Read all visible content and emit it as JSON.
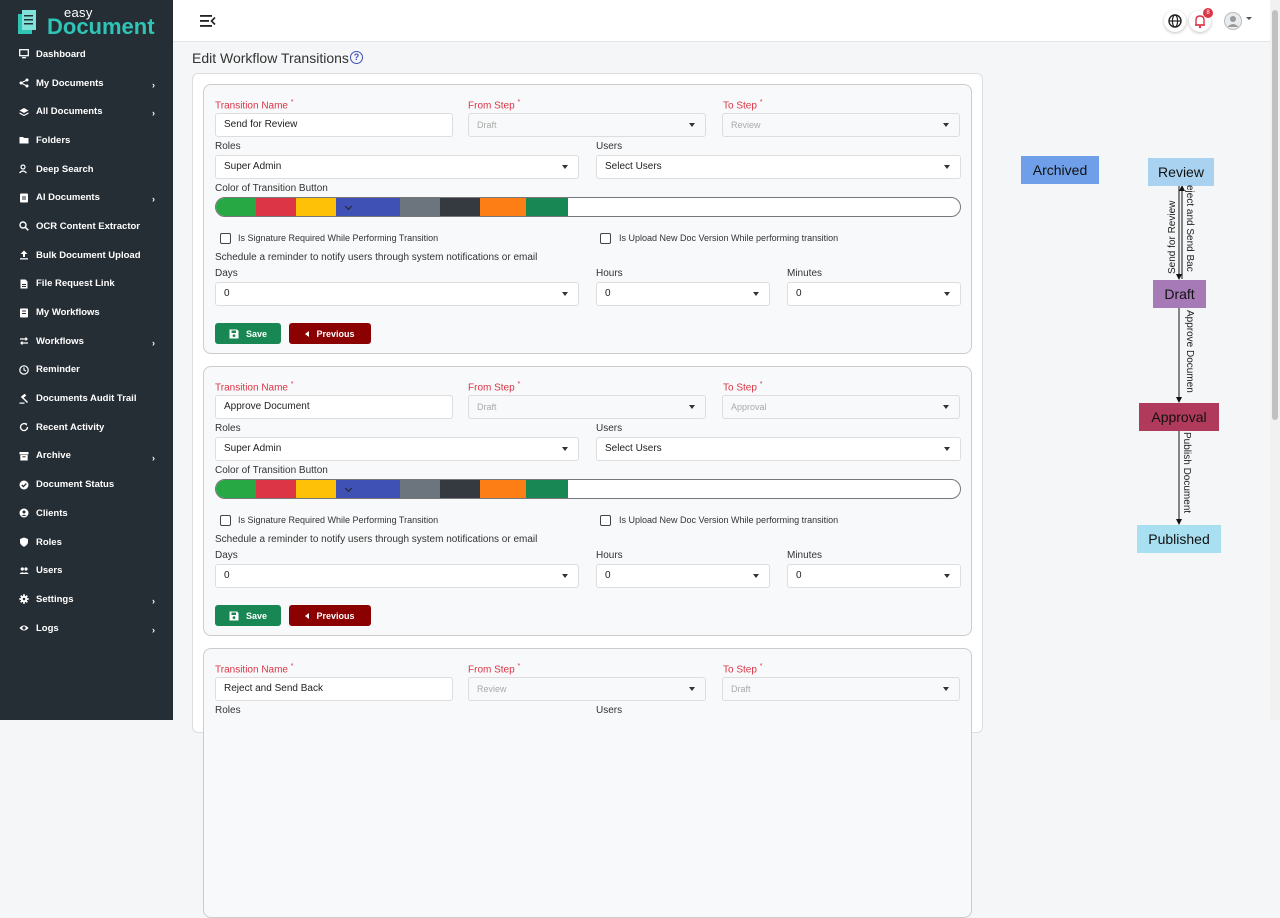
{
  "app": {
    "logo_small": "easy",
    "logo_large": "Document",
    "notification_count": "8",
    "page_title": "Edit Workflow Transitions",
    "help_glyph": "?"
  },
  "sidebar": {
    "items": [
      {
        "label": "Dashboard",
        "icon": "monitor-icon",
        "chevron": false
      },
      {
        "label": "My Documents",
        "icon": "share-icon",
        "chevron": true
      },
      {
        "label": "All Documents",
        "icon": "layers-icon",
        "chevron": true
      },
      {
        "label": "Folders",
        "icon": "folder-icon",
        "chevron": false
      },
      {
        "label": "Deep Search",
        "icon": "user-search-icon",
        "chevron": false
      },
      {
        "label": "AI Documents",
        "icon": "ai-document-icon",
        "chevron": true
      },
      {
        "label": "OCR Content Extractor",
        "icon": "search-icon",
        "chevron": false
      },
      {
        "label": "Bulk Document Upload",
        "icon": "upload-icon",
        "chevron": false
      },
      {
        "label": "File Request Link",
        "icon": "file-icon",
        "chevron": false
      },
      {
        "label": "My Workflows",
        "icon": "workflow-icon",
        "chevron": false
      },
      {
        "label": "Workflows",
        "icon": "repeat-icon",
        "chevron": true
      },
      {
        "label": "Reminder",
        "icon": "clock-icon",
        "chevron": false
      },
      {
        "label": "Documents Audit Trail",
        "icon": "gavel-icon",
        "chevron": false
      },
      {
        "label": "Recent Activity",
        "icon": "refresh-icon",
        "chevron": false
      },
      {
        "label": "Archive",
        "icon": "archive-icon",
        "chevron": true
      },
      {
        "label": "Document Status",
        "icon": "check-circle-icon",
        "chevron": false
      },
      {
        "label": "Clients",
        "icon": "client-icon",
        "chevron": false
      },
      {
        "label": "Roles",
        "icon": "shield-icon",
        "chevron": false
      },
      {
        "label": "Users",
        "icon": "users-icon",
        "chevron": false
      },
      {
        "label": "Settings",
        "icon": "gear-icon",
        "chevron": true
      },
      {
        "label": "Logs",
        "icon": "eye-icon",
        "chevron": true
      }
    ]
  },
  "form_labels": {
    "transition_name": "Transition Name",
    "from_step": "From Step",
    "to_step": "To Step",
    "required_mark": "*",
    "roles": "Roles",
    "users": "Users",
    "color": "Color of Transition Button",
    "signature": "Is Signature Required While Performing Transition",
    "upload": "Is Upload New Doc Version While performing transition",
    "schedule": "Schedule a reminder to notify users through system notifications or email",
    "days": "Days",
    "hours": "Hours",
    "minutes": "Minutes",
    "save": "Save",
    "previous": "Previous",
    "users_placeholder": "Select Users"
  },
  "colors": [
    "#28a745",
    "#dc3545",
    "#ffc107",
    "#3f51b5",
    "#6c757d",
    "#343a40",
    "#fd7e14",
    "#198754"
  ],
  "transitions": [
    {
      "name": "Send for Review",
      "from": "Draft",
      "to": "Review",
      "roles": "Super Admin",
      "users": "Select Users",
      "days": "0",
      "hours": "0",
      "minutes": "0"
    },
    {
      "name": "Approve Document",
      "from": "Draft",
      "to": "Approval",
      "roles": "Super Admin",
      "users": "Select Users",
      "days": "0",
      "hours": "0",
      "minutes": "0"
    },
    {
      "name": "Reject and Send Back",
      "from": "Review",
      "to": "Draft",
      "roles": "",
      "users": "",
      "days": "",
      "hours": "",
      "minutes": ""
    }
  ],
  "diagram": {
    "nodes": [
      {
        "label": "Archived",
        "color": "#6f9fe8"
      },
      {
        "label": "Review",
        "color": "#a9d2f0"
      },
      {
        "label": "Draft",
        "color": "#a67ab7"
      },
      {
        "label": "Approval",
        "color": "#b03a5b"
      },
      {
        "label": "Published",
        "color": "#a8e0f2"
      }
    ],
    "edges": [
      {
        "label": "Send for Review"
      },
      {
        "label": "eject and Send Bac"
      },
      {
        "label": "Approve Documen"
      },
      {
        "label": "Publish Document"
      }
    ]
  }
}
